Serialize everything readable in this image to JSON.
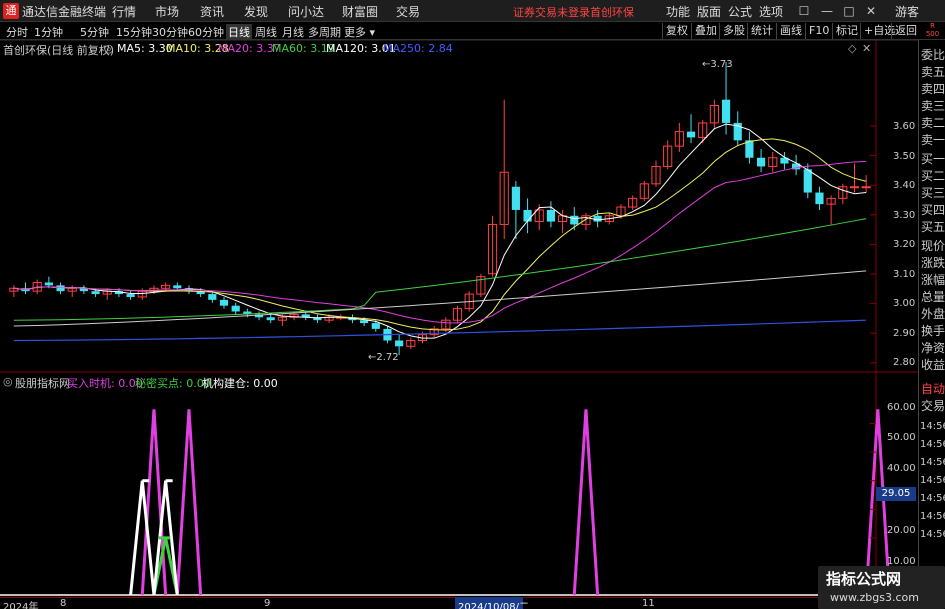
{
  "app": {
    "title": "通达信金融终端",
    "logo_text": "通",
    "login_status": "证券交易未登录",
    "security_name": "首创环保",
    "guest": "游客"
  },
  "menu": [
    "行情",
    "市场",
    "资讯",
    "发现",
    "问小达",
    "财富圈",
    "交易"
  ],
  "right_menu": [
    "功能",
    "版面",
    "公式",
    "选项"
  ],
  "periods": [
    "分时",
    "1分钟",
    "5分钟",
    "15分钟",
    "30分钟",
    "60分钟",
    "日线",
    "周线",
    "月线",
    "多周期",
    "更多 ▾"
  ],
  "active_period": "日线",
  "tools": [
    "复权",
    "叠加",
    "多股",
    "统计",
    "画线",
    "F10",
    "标记",
    "+自选",
    "返回"
  ],
  "r500": {
    "line1": "R",
    "line2": "500"
  },
  "main_chart": {
    "title": "首创环保(日线 前复权)",
    "ma": [
      {
        "label": "MA5: 3.30",
        "color": "#ffffff"
      },
      {
        "label": "MA10: 3.28",
        "color": "#f0f060"
      },
      {
        "label": "MA20: 3.37",
        "color": "#e040e0"
      },
      {
        "label": "MA60: 3.19",
        "color": "#40d040"
      },
      {
        "label": "MA120: 3.01",
        "color": "#ffffff"
      },
      {
        "label": "MA250: 2.84",
        "color": "#4060ff"
      }
    ],
    "y_ticks": [
      "3.60",
      "3.50",
      "3.40",
      "3.30",
      "3.20",
      "3.10",
      "3.00",
      "2.90",
      "2.80"
    ],
    "high_label": "3.73",
    "low_label": "2.72"
  },
  "indicator": {
    "title": "股朋指标网",
    "items": [
      {
        "label": "买入时机: 0.00",
        "color": "#e040e0"
      },
      {
        "label": "秘密买点: 0.00",
        "color": "#40d040"
      },
      {
        "label": "机构建仓: 0.00",
        "color": "#ffffff"
      }
    ],
    "y_ticks": [
      "60.00",
      "50.00",
      "40.00",
      "30.00",
      "20.00",
      "10.00"
    ],
    "current_value": "29.05"
  },
  "side_panel": [
    "委比",
    "卖五",
    "卖四",
    "卖三",
    "卖二",
    "卖一",
    "买一",
    "买二",
    "买三",
    "买四",
    "买五",
    "现价",
    "涨跌",
    "涨幅",
    "总量",
    "外盘",
    "换手",
    "净资",
    "收益",
    "自动",
    "交易"
  ],
  "times": [
    "14:56",
    "14:56",
    "14:56",
    "14:56",
    "14:56",
    "14:56",
    "14:56"
  ],
  "x_axis": [
    "2024年",
    "8",
    "9",
    "2024/10/08/二",
    "11"
  ],
  "watermark": {
    "line1": "指标公式网",
    "line2": "www.zbgs3.com"
  },
  "chart_data": {
    "type": "candlestick",
    "price_range": [
      2.72,
      3.73
    ],
    "candles": [
      [
        2.94,
        2.96,
        2.92,
        2.95
      ],
      [
        2.95,
        2.97,
        2.93,
        2.94
      ],
      [
        2.94,
        2.98,
        2.93,
        2.97
      ],
      [
        2.97,
        2.99,
        2.95,
        2.96
      ],
      [
        2.96,
        2.97,
        2.93,
        2.94
      ],
      [
        2.94,
        2.96,
        2.92,
        2.95
      ],
      [
        2.95,
        2.96,
        2.93,
        2.94
      ],
      [
        2.94,
        2.95,
        2.92,
        2.93
      ],
      [
        2.93,
        2.95,
        2.91,
        2.94
      ],
      [
        2.94,
        2.95,
        2.92,
        2.93
      ],
      [
        2.93,
        2.94,
        2.91,
        2.92
      ],
      [
        2.92,
        2.95,
        2.91,
        2.94
      ],
      [
        2.94,
        2.96,
        2.93,
        2.95
      ],
      [
        2.95,
        2.97,
        2.94,
        2.96
      ],
      [
        2.96,
        2.97,
        2.94,
        2.95
      ],
      [
        2.95,
        2.96,
        2.93,
        2.94
      ],
      [
        2.94,
        2.95,
        2.92,
        2.93
      ],
      [
        2.93,
        2.94,
        2.9,
        2.91
      ],
      [
        2.91,
        2.92,
        2.88,
        2.89
      ],
      [
        2.89,
        2.9,
        2.86,
        2.87
      ],
      [
        2.87,
        2.88,
        2.85,
        2.86
      ],
      [
        2.86,
        2.87,
        2.84,
        2.85
      ],
      [
        2.85,
        2.86,
        2.83,
        2.84
      ],
      [
        2.84,
        2.86,
        2.82,
        2.85
      ],
      [
        2.85,
        2.87,
        2.84,
        2.86
      ],
      [
        2.86,
        2.87,
        2.84,
        2.85
      ],
      [
        2.85,
        2.86,
        2.83,
        2.84
      ],
      [
        2.84,
        2.86,
        2.83,
        2.85
      ],
      [
        2.85,
        2.86,
        2.84,
        2.85
      ],
      [
        2.85,
        2.86,
        2.83,
        2.84
      ],
      [
        2.84,
        2.85,
        2.82,
        2.83
      ],
      [
        2.83,
        2.84,
        2.8,
        2.81
      ],
      [
        2.81,
        2.82,
        2.76,
        2.77
      ],
      [
        2.77,
        2.79,
        2.72,
        2.75
      ],
      [
        2.75,
        2.78,
        2.74,
        2.77
      ],
      [
        2.77,
        2.8,
        2.76,
        2.79
      ],
      [
        2.79,
        2.82,
        2.78,
        2.81
      ],
      [
        2.81,
        2.85,
        2.8,
        2.84
      ],
      [
        2.84,
        2.89,
        2.83,
        2.88
      ],
      [
        2.88,
        2.94,
        2.87,
        2.93
      ],
      [
        2.93,
        3.0,
        2.92,
        2.99
      ],
      [
        3.0,
        3.2,
        2.99,
        3.17
      ],
      [
        3.17,
        3.6,
        3.12,
        3.35
      ],
      [
        3.3,
        3.32,
        3.12,
        3.22
      ],
      [
        3.22,
        3.26,
        3.14,
        3.18
      ],
      [
        3.18,
        3.24,
        3.15,
        3.22
      ],
      [
        3.22,
        3.25,
        3.16,
        3.18
      ],
      [
        3.18,
        3.22,
        3.14,
        3.2
      ],
      [
        3.2,
        3.23,
        3.15,
        3.17
      ],
      [
        3.17,
        3.21,
        3.15,
        3.2
      ],
      [
        3.2,
        3.22,
        3.16,
        3.18
      ],
      [
        3.18,
        3.21,
        3.17,
        3.2
      ],
      [
        3.2,
        3.24,
        3.19,
        3.23
      ],
      [
        3.23,
        3.27,
        3.22,
        3.26
      ],
      [
        3.26,
        3.32,
        3.25,
        3.31
      ],
      [
        3.31,
        3.39,
        3.3,
        3.37
      ],
      [
        3.37,
        3.46,
        3.36,
        3.44
      ],
      [
        3.44,
        3.52,
        3.42,
        3.49
      ],
      [
        3.49,
        3.55,
        3.45,
        3.47
      ],
      [
        3.47,
        3.53,
        3.45,
        3.52
      ],
      [
        3.52,
        3.6,
        3.5,
        3.58
      ],
      [
        3.6,
        3.73,
        3.48,
        3.52
      ],
      [
        3.52,
        3.56,
        3.44,
        3.46
      ],
      [
        3.46,
        3.49,
        3.38,
        3.4
      ],
      [
        3.4,
        3.43,
        3.35,
        3.37
      ],
      [
        3.37,
        3.42,
        3.35,
        3.4
      ],
      [
        3.4,
        3.42,
        3.36,
        3.38
      ],
      [
        3.38,
        3.41,
        3.34,
        3.36
      ],
      [
        3.36,
        3.38,
        3.26,
        3.28
      ],
      [
        3.28,
        3.3,
        3.22,
        3.24
      ],
      [
        3.24,
        3.27,
        3.17,
        3.26
      ],
      [
        3.26,
        3.31,
        3.24,
        3.3
      ],
      [
        3.3,
        3.38,
        3.28,
        3.3
      ],
      [
        3.3,
        3.34,
        3.28,
        3.3
      ]
    ],
    "indicator_series": [
      {
        "name": "买入时机",
        "color": "#e040e0",
        "spikes": [
          [
            12,
            65
          ],
          [
            15,
            65
          ],
          [
            49,
            65
          ],
          [
            74,
            65
          ]
        ]
      },
      {
        "name": "秘密买点",
        "color": "#40d040",
        "spikes": [
          [
            13,
            20
          ]
        ]
      },
      {
        "name": "机构建仓",
        "color": "#ffffff",
        "spikes": [
          [
            11,
            40
          ],
          [
            13,
            40
          ]
        ]
      }
    ]
  }
}
